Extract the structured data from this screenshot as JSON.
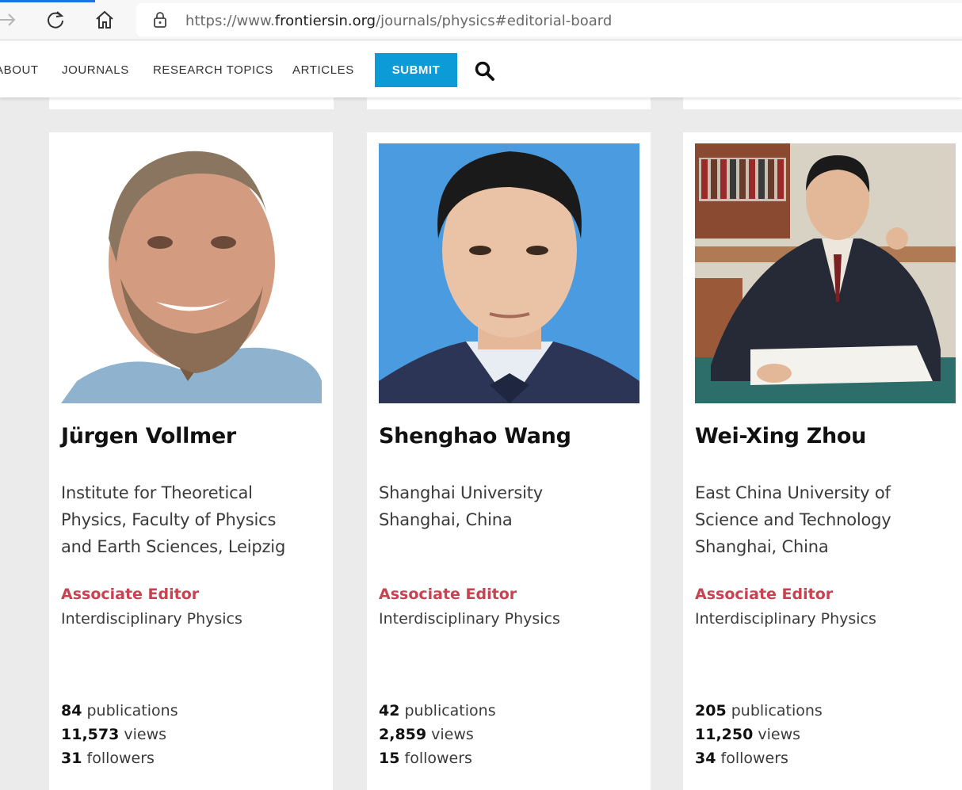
{
  "browser": {
    "url_prefix": "https://www.",
    "url_host": "frontiersin.org",
    "url_path": "/journals/physics#editorial-board"
  },
  "header": {
    "nav": [
      "ABOUT",
      "JOURNALS",
      "RESEARCH TOPICS",
      "ARTICLES"
    ],
    "submit_label": "SUBMIT"
  },
  "editors": [
    {
      "name": "Jürgen Vollmer",
      "affiliation": [
        "Institute for Theoretical",
        "Physics, Faculty of Physics",
        "and Earth Sciences, Leipzig"
      ],
      "role": "Associate Editor",
      "section": "Interdisciplinary Physics",
      "publications": "84",
      "publications_label": "publications",
      "views": "11,573",
      "views_label": "views",
      "followers": "31",
      "followers_label": "followers"
    },
    {
      "name": "Shenghao Wang",
      "affiliation": [
        "Shanghai University",
        "Shanghai, China"
      ],
      "role": "Associate Editor",
      "section": "Interdisciplinary Physics",
      "publications": "42",
      "publications_label": "publications",
      "views": "2,859",
      "views_label": "views",
      "followers": "15",
      "followers_label": "followers"
    },
    {
      "name": "Wei-Xing Zhou",
      "affiliation": [
        "East China University of",
        "Science and Technology",
        "Shanghai, China"
      ],
      "role": "Associate Editor",
      "section": "Interdisciplinary Physics",
      "publications": "205",
      "publications_label": "publications",
      "views": "11,250",
      "views_label": "views",
      "followers": "34",
      "followers_label": "followers"
    }
  ],
  "colors": {
    "accent": "#0c9bd6",
    "role": "#c8424f",
    "background": "#ebebeb"
  }
}
